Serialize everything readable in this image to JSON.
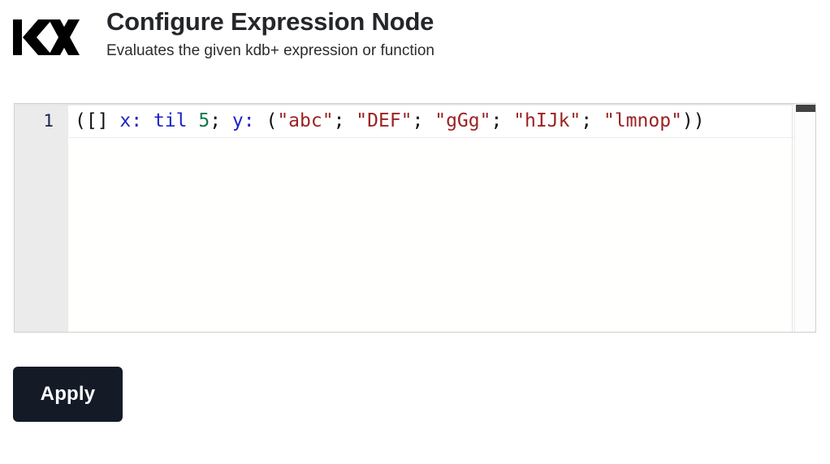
{
  "header": {
    "logo_text": "KX",
    "logo_icon": "kx-logo",
    "title": "Configure Expression Node",
    "subtitle": "Evaluates the given kdb+ expression or function"
  },
  "editor": {
    "line_numbers": [
      "1"
    ],
    "code_raw": "([] x: til 5; y: (\"abc\"; \"DEF\"; \"gGg\"; \"hIJk\"; \"lmnop\"))",
    "tokens": [
      {
        "text": "([] ",
        "type": "plain"
      },
      {
        "text": "x:",
        "type": "ident"
      },
      {
        "text": " ",
        "type": "plain"
      },
      {
        "text": "til",
        "type": "kw"
      },
      {
        "text": " ",
        "type": "plain"
      },
      {
        "text": "5",
        "type": "num"
      },
      {
        "text": "; ",
        "type": "plain"
      },
      {
        "text": "y:",
        "type": "ident"
      },
      {
        "text": " (",
        "type": "plain"
      },
      {
        "text": "\"abc\"",
        "type": "str"
      },
      {
        "text": "; ",
        "type": "plain"
      },
      {
        "text": "\"DEF\"",
        "type": "str"
      },
      {
        "text": "; ",
        "type": "plain"
      },
      {
        "text": "\"gGg\"",
        "type": "str"
      },
      {
        "text": "; ",
        "type": "plain"
      },
      {
        "text": "\"hIJk\"",
        "type": "str"
      },
      {
        "text": "; ",
        "type": "plain"
      },
      {
        "text": "\"lmnop\"",
        "type": "str"
      },
      {
        "text": "))",
        "type": "plain"
      }
    ],
    "colors": {
      "plain": "#111111",
      "identifier": "#1d23c8",
      "keyword": "#1d23c8",
      "number": "#137a4a",
      "string": "#9c2222",
      "gutter_bg": "#ebebeb",
      "line_number": "#16264f",
      "border": "#cfcfcf",
      "background": "#fffffd"
    }
  },
  "scrollbar": {
    "vertical_thumb_visible": true,
    "thumb_color": "#424242"
  },
  "footer": {
    "apply_label": "Apply",
    "apply_bg": "#141b27",
    "apply_fg": "#ffffff"
  }
}
